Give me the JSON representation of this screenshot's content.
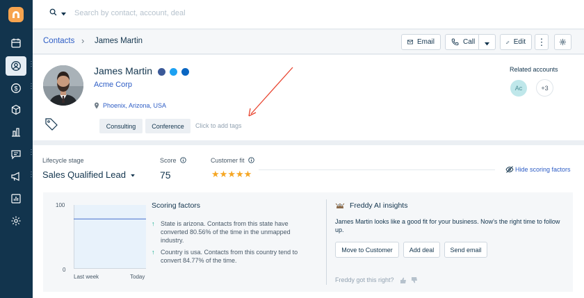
{
  "search": {
    "placeholder": "Search by contact, account, deal"
  },
  "breadcrumb": {
    "link": "Contacts",
    "separator": "›",
    "current": "James Martin"
  },
  "header_buttons": {
    "email": "Email",
    "call": "Call",
    "edit": "Edit"
  },
  "contact": {
    "name": "James Martin",
    "company": "Acme Corp",
    "location": "Phoenix, Arizona, USA",
    "tags": [
      "Consulting",
      "Conference"
    ],
    "add_tags_text": "Click to add tags"
  },
  "related_accounts": {
    "label": "Related accounts",
    "badge": "Ac",
    "more": "+3"
  },
  "scoring": {
    "lifecycle_label": "Lifecycle stage",
    "lifecycle_value": "Sales Qualified Lead",
    "score_label": "Score",
    "score_value": "75",
    "fit_label": "Customer fit",
    "fit_stars": 5,
    "hide_link": "Hide scoring factors"
  },
  "chart_data": {
    "type": "area",
    "x": [
      "Last week",
      "Today"
    ],
    "values": [
      78,
      78
    ],
    "ylim": [
      0,
      100
    ],
    "yticks": [
      "100",
      "0"
    ]
  },
  "scoring_factors": {
    "title": "Scoring factors",
    "items": [
      "State is arizona. Contacts from this state have converted 80.56% of the time in the unmapped industry.",
      "Country is usa. Contacts from this country tend to convert 84.77% of the time."
    ]
  },
  "ai": {
    "title": "Freddy AI insights",
    "text": "James Martin looks like a good fit for your business. Now's the right time to follow up.",
    "buttons": [
      "Move to Customer",
      "Add deal",
      "Send email"
    ],
    "feedback": "Freddy got this right?"
  },
  "colors": {
    "sidebar": "#12344d",
    "accent": "#2c5cc5",
    "star": "#f5a623",
    "annotation_arrow": "#e8432e"
  }
}
